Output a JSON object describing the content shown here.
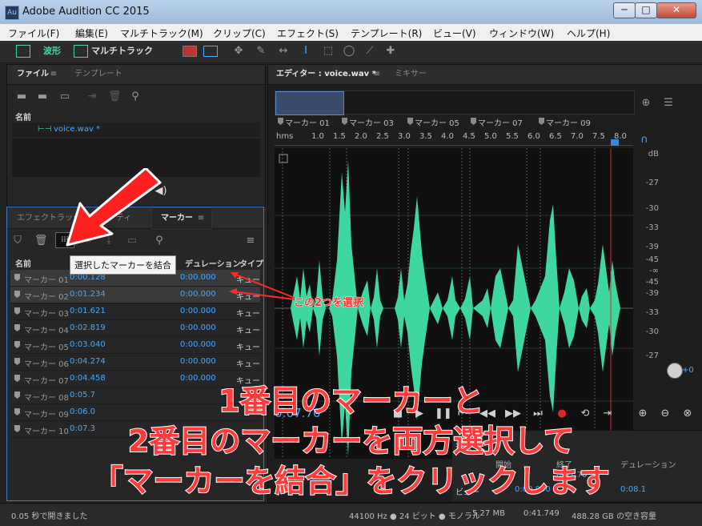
{
  "window": {
    "title": "Adobe Audition CC 2015",
    "app_icon": "Au",
    "minimize": "─",
    "maximize": "□",
    "close": "✕"
  },
  "menu": [
    "ファイル(F)",
    "編集(E)",
    "マルチトラック(M)",
    "クリップ(C)",
    "エフェクト(S)",
    "テンプレート(R)",
    "ビュー(V)",
    "ウィンドウ(W)",
    "ヘルプ(H)"
  ],
  "toolbar": {
    "waveform_label": "波形",
    "multitrack_label": "マルチトラック"
  },
  "files_panel": {
    "tabs": [
      "ファイル",
      "テンプレート"
    ],
    "name_header": "名前",
    "file_name": "voice.wav *"
  },
  "markers_panel": {
    "tabs": [
      "エフェクトラック",
      "ティ",
      "マーカー"
    ],
    "tooltip": "選択したマーカーを結合",
    "headers": {
      "name": "名前",
      "duration": "デュレーション",
      "type": "タイプ"
    },
    "rows": [
      {
        "name": "マーカー 01",
        "start": "0:00.128",
        "duration": "0:00.000",
        "type": "キュー",
        "selected": true
      },
      {
        "name": "マーカー 02",
        "start": "0:01.234",
        "duration": "0:00.000",
        "type": "キュー",
        "selected": true
      },
      {
        "name": "マーカー 03",
        "start": "0:01.621",
        "duration": "0:00.000",
        "type": "キュー",
        "selected": false
      },
      {
        "name": "マーカー 04",
        "start": "0:02.819",
        "duration": "0:00.000",
        "type": "キュー",
        "selected": false
      },
      {
        "name": "マーカー 05",
        "start": "0:03.040",
        "duration": "0:00.000",
        "type": "キュー",
        "selected": false
      },
      {
        "name": "マーカー 06",
        "start": "0:04.274",
        "duration": "0:00.000",
        "type": "キュー",
        "selected": false
      },
      {
        "name": "マーカー 07",
        "start": "0:04.458",
        "duration": "0:00.000",
        "type": "キュー",
        "selected": false
      },
      {
        "name": "マーカー 08",
        "start": "0:05.7",
        "duration": "",
        "type": "",
        "selected": false
      },
      {
        "name": "マーカー 09",
        "start": "0:06.0",
        "duration": "",
        "type": "",
        "selected": false
      },
      {
        "name": "マーカー 10",
        "start": "0:07.3",
        "duration": "",
        "type": "",
        "selected": false
      }
    ]
  },
  "editor": {
    "tab_label": "エディター : voice.wav *",
    "mixer_tab": "ミキサー",
    "markers_ruler": [
      "マーカー 01",
      "マーカー 03",
      "マーカー 05",
      "マーカー 07",
      "マーカー 09"
    ],
    "time_ticks": [
      "hms",
      "1.0",
      "1.5",
      "2.0",
      "2.5",
      "3.0",
      "3.5",
      "4.0",
      "4.5",
      "5.0",
      "5.5",
      "6.0",
      "6.5",
      "7.0",
      "7.5",
      "8.0"
    ],
    "db_scale": [
      "dB",
      "-27",
      "-30",
      "-33",
      "-39",
      "-45",
      "-∞",
      "-45",
      "-39",
      "-33",
      "-30",
      "-27"
    ],
    "time_display": "0:07.70",
    "selection_headers": [
      "開始",
      "終了",
      "デュレーション"
    ],
    "selection_label": "選択",
    "view_label": "ビュー",
    "end_value": "0:07.70",
    "partial_values": [
      "0:00.000",
      "0:08.1"
    ],
    "level_value": "+0"
  },
  "annotations": {
    "callout": "この2つを選択",
    "caption_lines": [
      "1番目のマーカーと",
      "2番目のマーカーを両方選択して",
      "「マーカーを結合」をクリックします"
    ]
  },
  "status": {
    "left": "0.05 秒で開きました",
    "sample_rate": "44100 Hz ● 24 ビット ● モノラル",
    "size": "5.27 MB",
    "duration": "0:41.749",
    "free": "488.28 GB の空き容量"
  },
  "colors": {
    "waveform": "#3fd7a0",
    "playhead": "#d9292c",
    "accent_blue": "#4aa8ff",
    "annotation_red": "#ff3b3b"
  }
}
